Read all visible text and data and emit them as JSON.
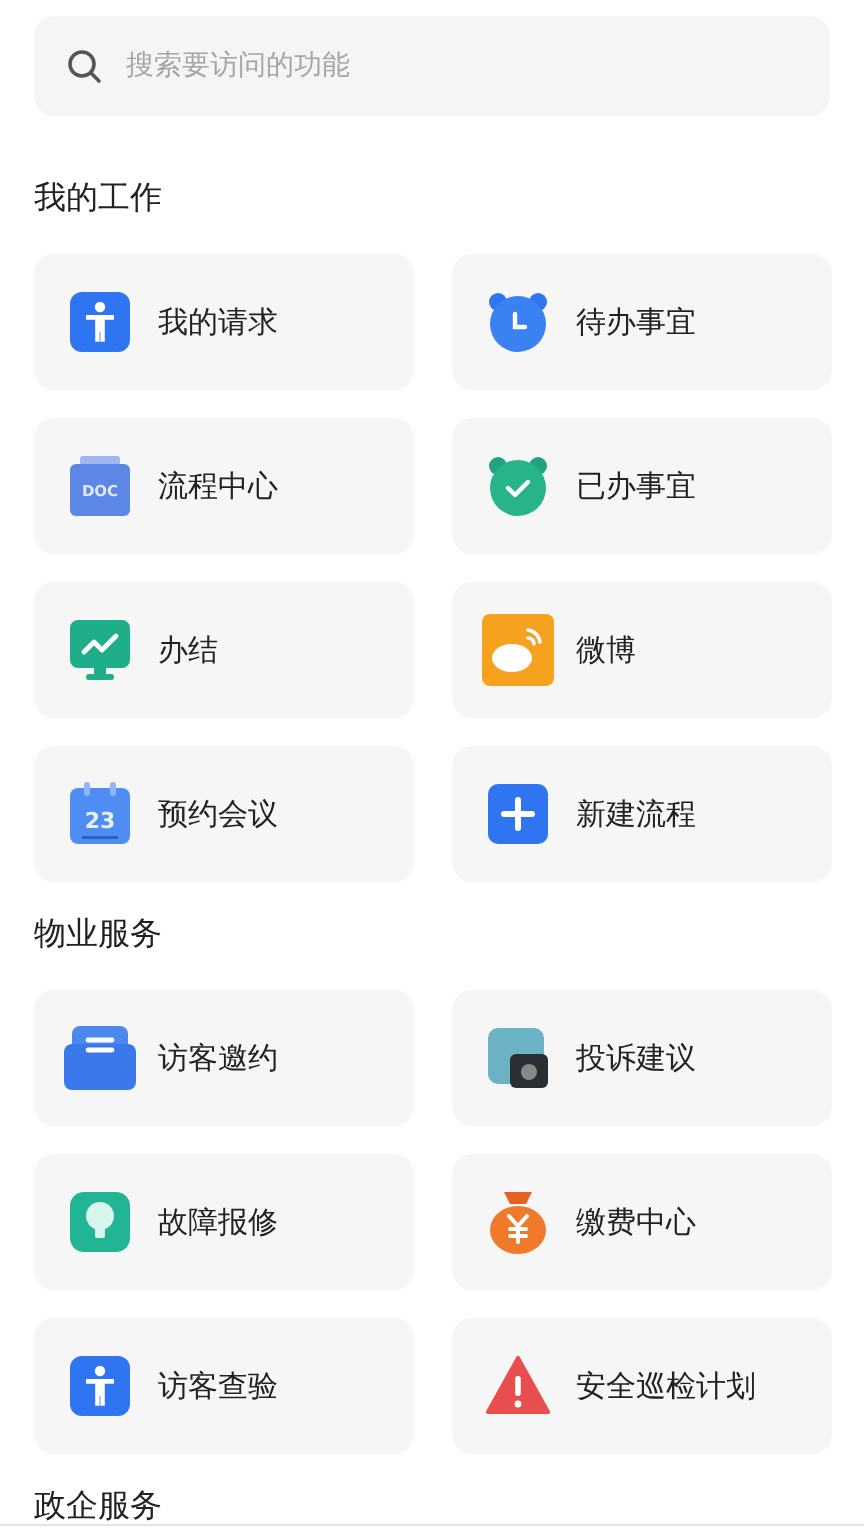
{
  "search": {
    "placeholder": "搜索要访问的功能"
  },
  "sections": [
    {
      "title": "我的工作",
      "items": [
        {
          "label": "我的请求",
          "kind": "person"
        },
        {
          "label": "待办事宜",
          "kind": "clock"
        },
        {
          "label": "流程中心",
          "kind": "doc",
          "icon_text": "DOC"
        },
        {
          "label": "已办事宜",
          "kind": "check"
        },
        {
          "label": "办结",
          "kind": "chart"
        },
        {
          "label": "微博",
          "kind": "cloud"
        },
        {
          "label": "预约会议",
          "kind": "calendar",
          "icon_text": "23"
        },
        {
          "label": "新建流程",
          "kind": "plus"
        }
      ]
    },
    {
      "title": "物业服务",
      "items": [
        {
          "label": "访客邀约",
          "kind": "inbox"
        },
        {
          "label": "投诉建议",
          "kind": "camera"
        },
        {
          "label": "故障报修",
          "kind": "bulb"
        },
        {
          "label": "缴费中心",
          "kind": "bag"
        },
        {
          "label": "访客查验",
          "kind": "person"
        },
        {
          "label": "安全巡检计划",
          "kind": "warning"
        }
      ]
    },
    {
      "title": "政企服务"
    }
  ]
}
